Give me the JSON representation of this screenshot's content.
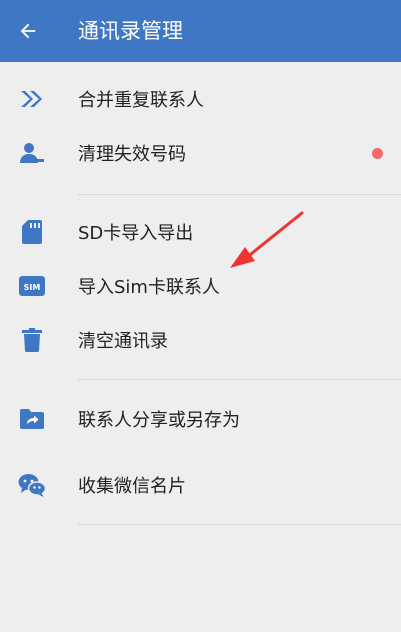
{
  "header": {
    "title": "通讯录管理",
    "back_icon": "arrow-left-icon"
  },
  "colors": {
    "app_bar": "#3f77c4",
    "icon": "#3f77c4",
    "background": "#eeeeee",
    "badge": "#f26a6a",
    "annotation_arrow": "#ee3333"
  },
  "sections": [
    {
      "items": [
        {
          "label": "合并重复联系人",
          "icon": "double-chevron-right-icon"
        },
        {
          "label": "清理失效号码",
          "icon": "person-remove-icon",
          "badge": true
        }
      ]
    },
    {
      "items": [
        {
          "label": "SD卡导入导出",
          "icon": "sd-card-icon"
        },
        {
          "label": "导入Sim卡联系人",
          "icon": "sim-card-icon",
          "icon_text": "SIM"
        },
        {
          "label": "清空通讯录",
          "icon": "trash-icon"
        }
      ]
    },
    {
      "items": [
        {
          "label": "联系人分享或另存为",
          "icon": "folder-share-icon"
        },
        {
          "label": "收集微信名片",
          "icon": "wechat-icon"
        }
      ]
    }
  ]
}
